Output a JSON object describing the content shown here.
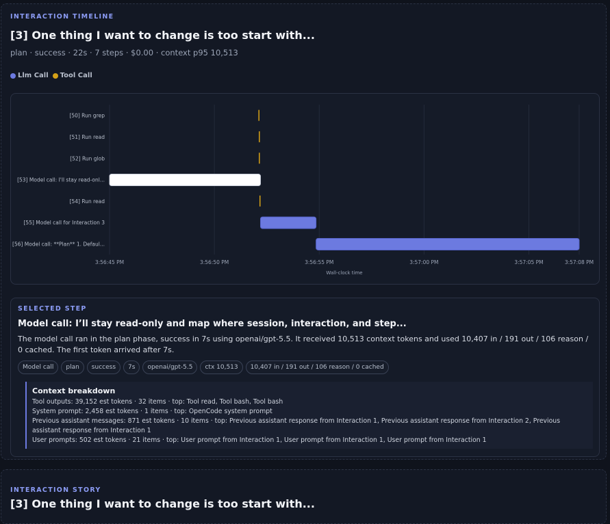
{
  "timeline": {
    "kicker": "INTERACTION TIMELINE",
    "title": "[3] One thing I want to change is too start with...",
    "meta": "plan · success · 22s · 7 steps · $0.00 · context p95 10,513",
    "legend": [
      {
        "label": "Llm Call",
        "color": "#6c7ae0"
      },
      {
        "label": "Tool Call",
        "color": "#d4a017"
      }
    ]
  },
  "chart_data": {
    "type": "gantt",
    "xlabel": "Wall-clock time",
    "x_ticks": [
      "3:56:45 PM",
      "3:56:50 PM",
      "3:56:55 PM",
      "3:57:00 PM",
      "3:57:05 PM",
      "3:57:08 PM"
    ],
    "x_tick_seconds": [
      0,
      5,
      10,
      15,
      20,
      22.4
    ],
    "xlim_seconds": [
      0,
      22.4
    ],
    "rows": [
      {
        "label": "[50] Run grep",
        "kind": "tool",
        "start": 7.1,
        "end": 7.15
      },
      {
        "label": "[51] Run read",
        "kind": "tool",
        "start": 7.12,
        "end": 7.17
      },
      {
        "label": "[52] Run glob",
        "kind": "tool",
        "start": 7.12,
        "end": 7.17
      },
      {
        "label": "[53] Model call: I'll stay read-onl...",
        "kind": "llm",
        "selected": true,
        "start": 0.0,
        "end": 7.2
      },
      {
        "label": "[54] Run read",
        "kind": "tool",
        "start": 7.15,
        "end": 7.2
      },
      {
        "label": "[55] Model call for Interaction 3",
        "kind": "llm",
        "start": 7.2,
        "end": 9.85
      },
      {
        "label": "[56] Model call: **Plan** 1. Defaul...",
        "kind": "llm",
        "start": 9.85,
        "end": 22.4
      }
    ],
    "colors": {
      "llm": "#6c7ae0",
      "tool": "#d4a017",
      "selected": "#ffffff"
    }
  },
  "selected": {
    "kicker": "SELECTED STEP",
    "title": "Model call: I’ll stay read-only and map where session, interaction, and step...",
    "summary": "The model call ran in the plan phase, success in 7s using openai/gpt-5.5. It received 10,513 context tokens and used 10,407 in / 191 out / 106 reason / 0 cached. The first token arrived after 7s.",
    "tags": [
      "Model call",
      "plan",
      "success",
      "7s",
      "openai/gpt-5.5",
      "ctx 10,513",
      "10,407 in / 191 out / 106 reason / 0 cached"
    ],
    "context": {
      "heading": "Context breakdown",
      "lines": [
        "Tool outputs: 39,152 est tokens · 32 items · top: Tool read, Tool bash, Tool bash",
        "System prompt: 2,458 est tokens · 1 items · top: OpenCode system prompt",
        "Previous assistant messages: 871 est tokens · 10 items · top: Previous assistant response from Interaction 1, Previous assistant response from Interaction 2, Previous assistant response from Interaction 1",
        "User prompts: 502 est tokens · 21 items · top: User prompt from Interaction 1, User prompt from Interaction 1, User prompt from Interaction 1"
      ]
    }
  },
  "story": {
    "kicker": "INTERACTION STORY",
    "title": "[3] One thing I want to change is too start with..."
  }
}
